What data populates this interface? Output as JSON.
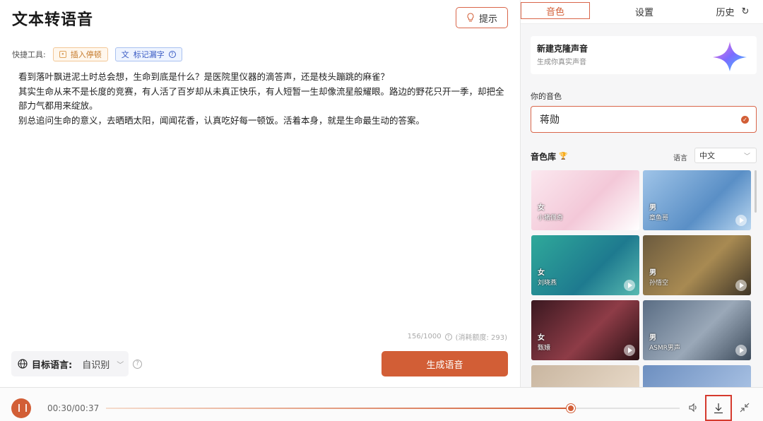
{
  "header": {
    "title": "文本转语音",
    "hint_label": "提示"
  },
  "quick_tools": {
    "label": "快捷工具:",
    "insert_pause": "插入停顿",
    "mark_missing": "标记漏字"
  },
  "content": {
    "lines": [
      "看到落叶飘进泥土时总会想，生命到底是什么？是医院里仪器的滴答声，还是枝头蹦跳的麻雀？",
      "其实生命从来不是长度的竞赛，有人活了百岁却从未真正快乐，有人短暂一生却像流星般耀眼。路边的野花只开一季，却把全部力气都用来绽放。",
      "别总追问生命的意义，去晒晒太阳，闻闻花香，认真吃好每一顿饭。活着本身，就是生命最生动的答案。"
    ],
    "char_count": "156/1000",
    "quota": "(消耗额度: 293)"
  },
  "target_language": {
    "label": "目标语言:",
    "value": "自识别"
  },
  "generate_label": "生成语音",
  "right_panel": {
    "tabs": [
      "音色",
      "设置",
      "历史"
    ],
    "active_tab": 0,
    "clone": {
      "title": "新建克隆声音",
      "subtitle": "生成你真实声音"
    },
    "your_voice_label": "你的音色",
    "selected_voice": "蒋勋",
    "library_label": "音色库",
    "language_label": "语言",
    "language_value": "中文",
    "voices": [
      {
        "gender": "女",
        "name": "小猪佩奇"
      },
      {
        "gender": "男",
        "name": "章鱼哥"
      },
      {
        "gender": "女",
        "name": "刘晓燕"
      },
      {
        "gender": "男",
        "name": "孙悟空"
      },
      {
        "gender": "女",
        "name": "甄嬛"
      },
      {
        "gender": "男",
        "name": "ASMR男声"
      }
    ]
  },
  "player": {
    "time": "00:30/00:37",
    "progress": 0.81
  }
}
